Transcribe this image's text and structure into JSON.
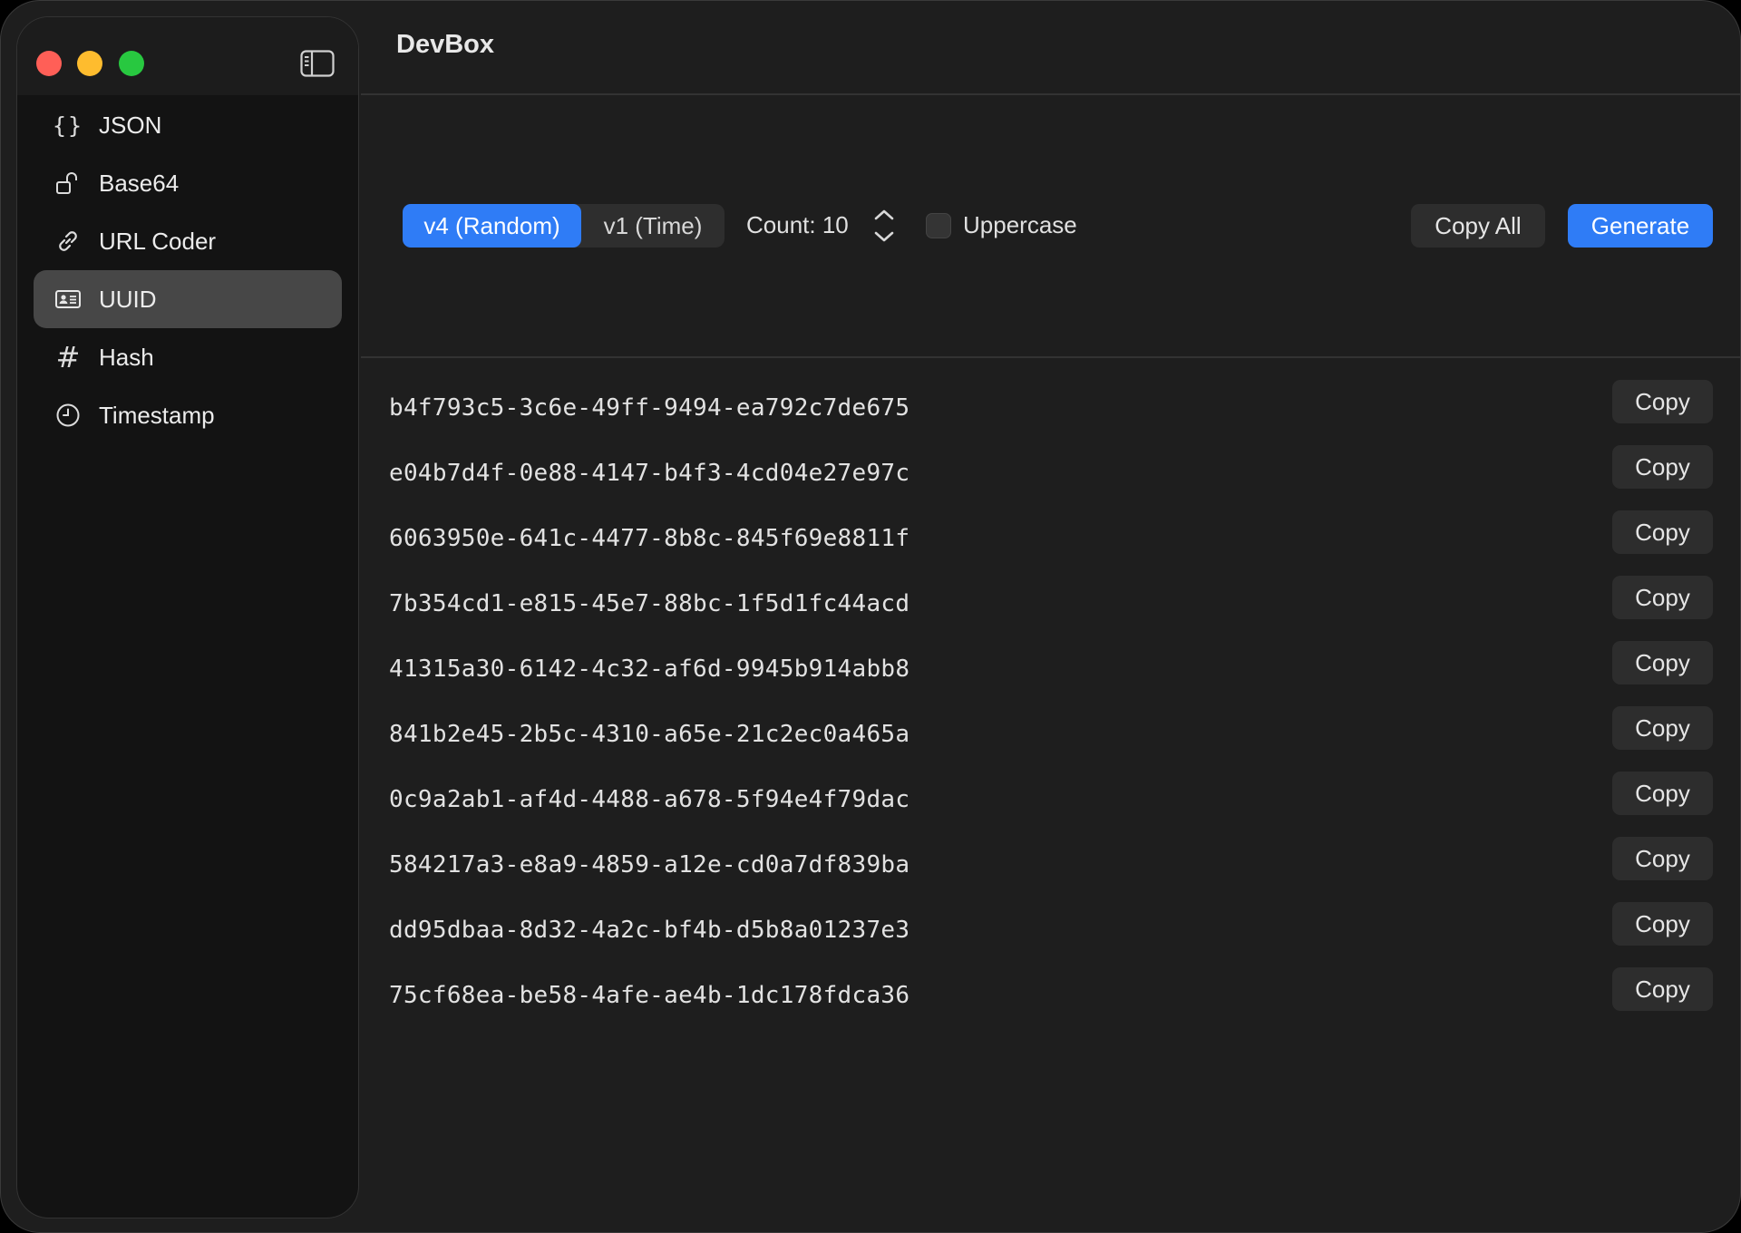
{
  "window": {
    "title": "DevBox"
  },
  "sidebar": {
    "items": [
      {
        "label": "JSON",
        "icon": "braces-icon",
        "active": false
      },
      {
        "label": "Base64",
        "icon": "unlock-icon",
        "active": false
      },
      {
        "label": "URL Coder",
        "icon": "link-icon",
        "active": false
      },
      {
        "label": "UUID",
        "icon": "id-card-icon",
        "active": true
      },
      {
        "label": "Hash",
        "icon": "hash-icon",
        "active": false
      },
      {
        "label": "Timestamp",
        "icon": "clock-icon",
        "active": false
      }
    ]
  },
  "toolbar": {
    "version_options": [
      "v4 (Random)",
      "v1 (Time)"
    ],
    "selected_version": "v4 (Random)",
    "count_label": "Count: 10",
    "uppercase_label": "Uppercase",
    "uppercase_checked": false,
    "copy_all_label": "Copy All",
    "generate_label": "Generate"
  },
  "uuids": [
    "b4f793c5-3c6e-49ff-9494-ea792c7de675",
    "e04b7d4f-0e88-4147-b4f3-4cd04e27e97c",
    "6063950e-641c-4477-8b8c-845f69e8811f",
    "7b354cd1-e815-45e7-88bc-1f5d1fc44acd",
    "41315a30-6142-4c32-af6d-9945b914abb8",
    "841b2e45-2b5c-4310-a65e-21c2ec0a465a",
    "0c9a2ab1-af4d-4488-a678-5f94e4f79dac",
    "584217a3-e8a9-4859-a12e-cd0a7df839ba",
    "dd95dbaa-8d32-4a2c-bf4b-d5b8a01237e3",
    "75cf68ea-be58-4afe-ae4b-1dc178fdca36"
  ],
  "row_copy_label": "Copy",
  "colors": {
    "accent": "#2f7cf6",
    "window_bg": "#1e1e1e",
    "sidebar_bg": "#131313",
    "selected_item_bg": "#474747",
    "traffic_red": "#ff5f57",
    "traffic_yellow": "#febc2e",
    "traffic_green": "#28c840"
  }
}
